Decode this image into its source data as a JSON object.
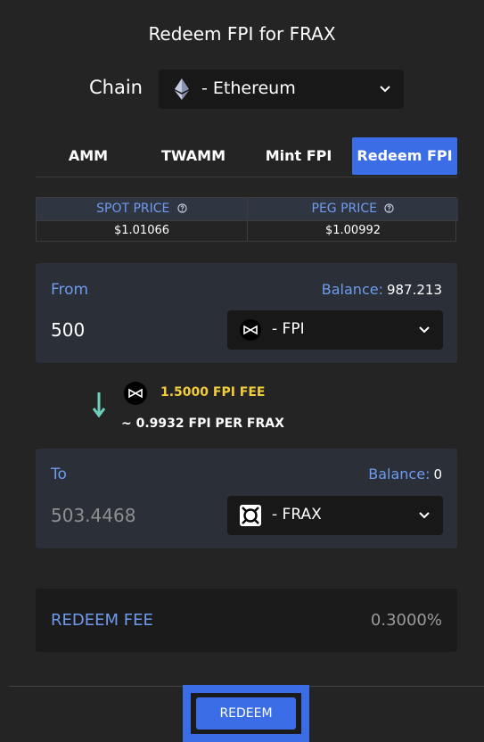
{
  "title": "Redeem FPI for FRAX",
  "chain": {
    "label": "Chain",
    "value": "- Ethereum",
    "icon": "ethereum-icon"
  },
  "tabs": [
    {
      "label": "AMM",
      "active": false
    },
    {
      "label": "TWAMM",
      "active": false
    },
    {
      "label": "Mint FPI",
      "active": false
    },
    {
      "label": "Redeem FPI",
      "active": true
    }
  ],
  "prices": {
    "spot_label": "SPOT PRICE",
    "spot_value": "$1.01066",
    "peg_label": "PEG PRICE",
    "peg_value": "$1.00992"
  },
  "from": {
    "label": "From",
    "balance_label": "Balance:",
    "balance_value": "987.213",
    "amount": "500",
    "token": "- FPI",
    "token_icon": "fpi-icon"
  },
  "fee_info": {
    "fee": "1.5000 FPI FEE",
    "rate": "~ 0.9932 FPI PER FRAX",
    "arrow_icon": "arrow-down-icon"
  },
  "to": {
    "label": "To",
    "balance_label": "Balance:",
    "balance_value": "0",
    "amount": "503.4468",
    "token": "- FRAX",
    "token_icon": "frax-icon"
  },
  "redeem_fee": {
    "label": "REDEEM FEE",
    "value": "0.3000%"
  },
  "redeem_button": "REDEEM",
  "colors": {
    "accent": "#3b6ee6",
    "label_blue": "#6f9bef",
    "fee_yellow": "#f2cc3b",
    "panel": "#2a2f38",
    "background": "#242424"
  }
}
